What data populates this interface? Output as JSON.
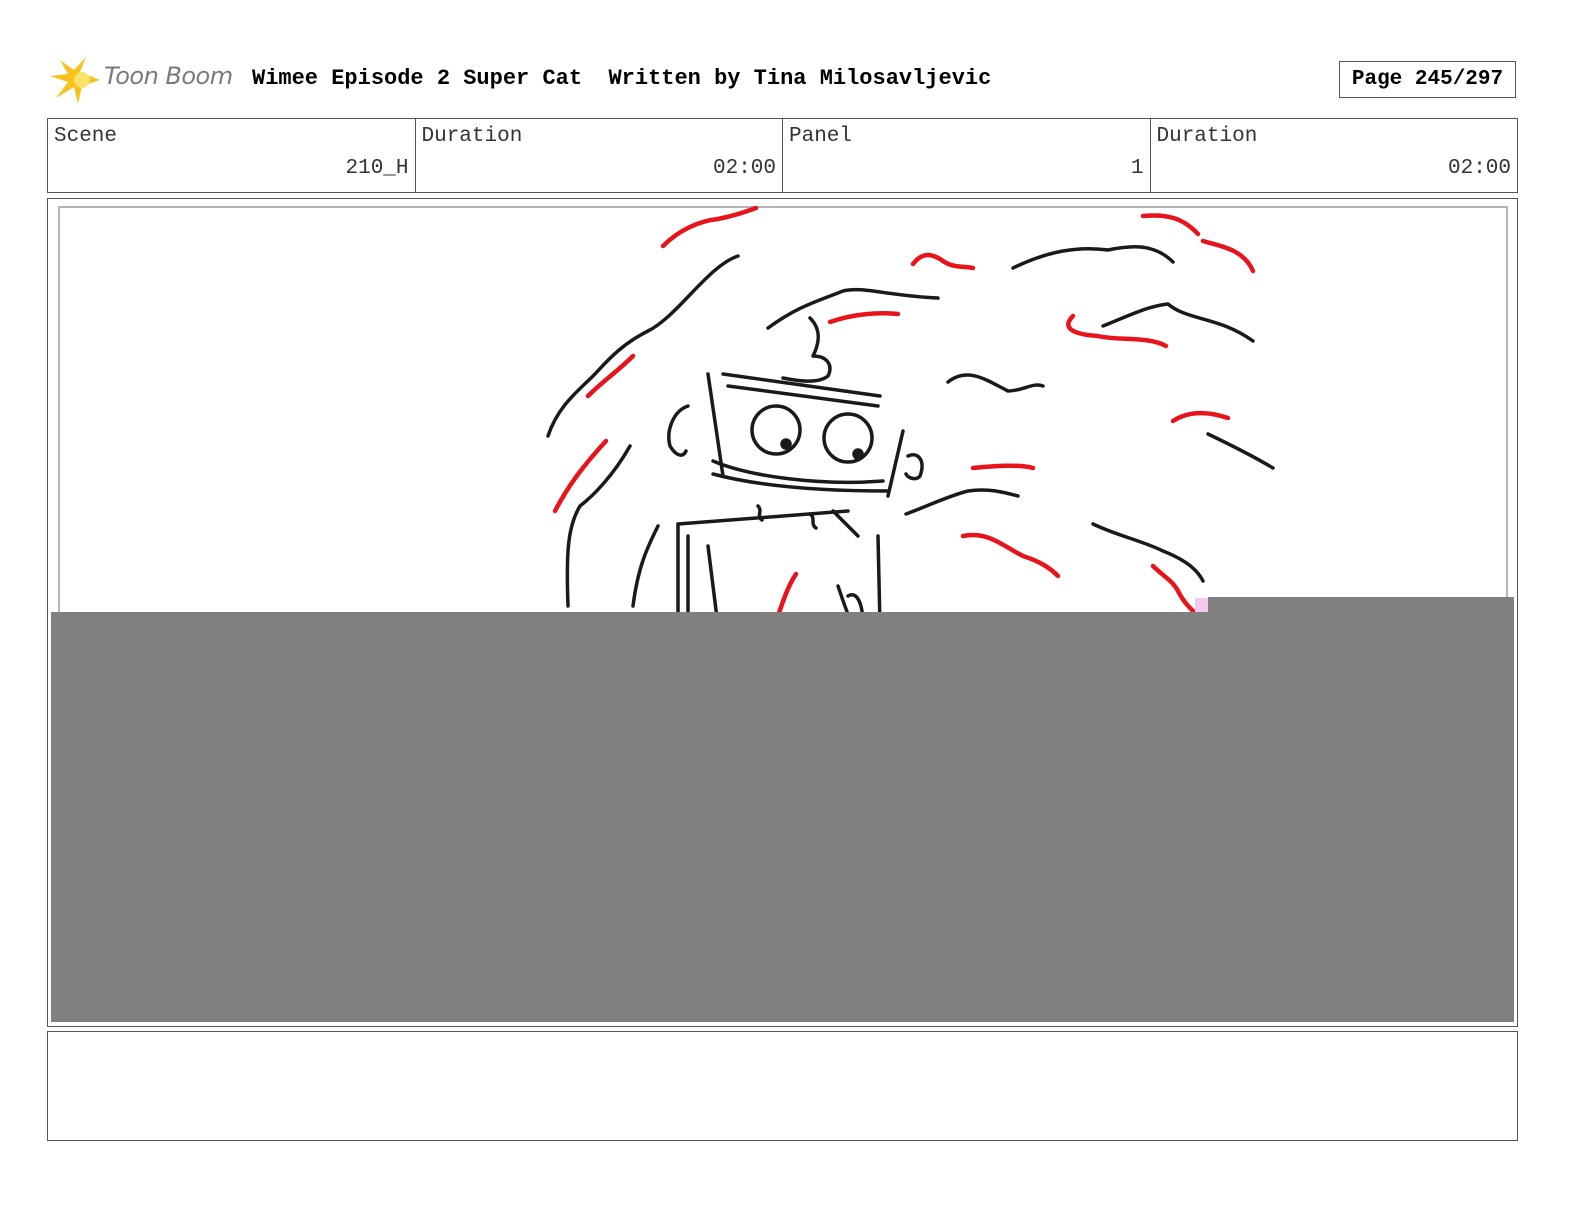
{
  "header": {
    "logo_text": "Toon Boom",
    "title": "Wimee Episode 2 Super Cat  Written by Tina Milosavljevic",
    "page": "Page 245/297"
  },
  "info": {
    "scene_label": "Scene",
    "scene_value": "210_H",
    "duration_label": "Duration",
    "duration_value": "02:00",
    "panel_label": "Panel",
    "panel_value": "1",
    "panel_duration_label": "Duration",
    "panel_duration_value": "02:00"
  },
  "colors": {
    "sketch_black": "#1a1a1a",
    "sketch_red": "#e8141b",
    "logo_yellow": "#f7c21b",
    "redaction_gray": "#808080"
  },
  "notes": {
    "text": ""
  }
}
